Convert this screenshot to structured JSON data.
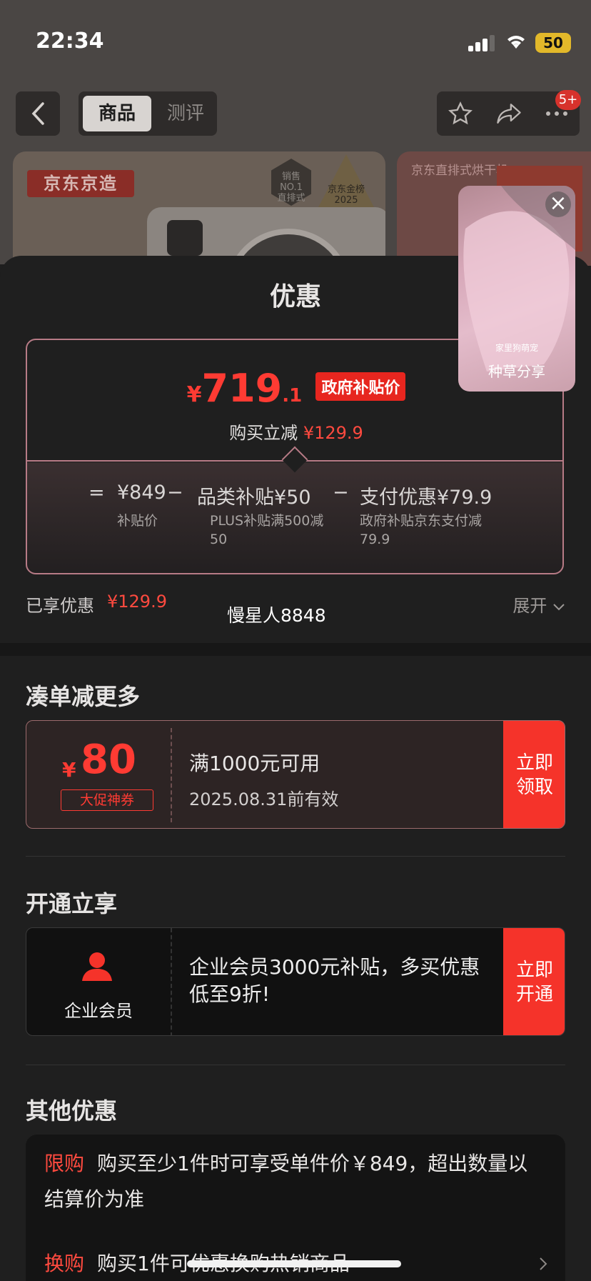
{
  "status_bar": {
    "time": "22:34",
    "battery": "50"
  },
  "nav": {
    "tabs": [
      {
        "label": "商品"
      },
      {
        "label": "测评"
      }
    ],
    "message_badge": "5+"
  },
  "product_images": {
    "brand_label": "京东京造",
    "sales_badge": "销售\nNO.1\n直排式",
    "gold_badge": "京东金榜\n2025",
    "second_title": "京东直排式烘干机…"
  },
  "floating_video": {
    "close": "×",
    "overlay_text": "家里狗萌宠",
    "caption": "种草分享"
  },
  "sheet": {
    "title": "优惠",
    "price": {
      "currency": "¥",
      "integer": "719",
      "decimal": ".1",
      "tag": "政府补贴价",
      "instant_label": "购买立减",
      "instant_value": "¥129.9"
    },
    "formula": {
      "equals": "=",
      "base_value": "¥849",
      "base_label": "补贴价",
      "minus": "−",
      "item1_value": "品类补贴¥50",
      "item1_label": "PLUS补贴满500减50",
      "item2_value": "支付优惠¥79.9",
      "item2_label": "政府补贴京东支付减79.9"
    },
    "enjoyed": {
      "label": "已享优惠",
      "value": "¥129.9",
      "expand": "展开"
    },
    "watermark": "慢星人8848",
    "more_section": {
      "title": "凑单减更多",
      "coupon": {
        "currency": "¥",
        "amount": "80",
        "tag": "大促神券",
        "condition": "满1000元可用",
        "expiry": "2025.08.31前有效",
        "button": "立即\n领取"
      }
    },
    "member_section": {
      "title": "开通立享",
      "label": "企业会员",
      "desc": "企业会员3000元补贴，多买优惠低至9折!",
      "button": "立即\n开通"
    },
    "other_section": {
      "title": "其他优惠",
      "rows": [
        {
          "tag": "限购",
          "text": "购买至少1件时可享受单件价￥849，超出数量以结算价为准"
        },
        {
          "tag": "换购",
          "text": "购买1件可优惠换购热销商品"
        }
      ]
    }
  },
  "colors": {
    "accent": "#f5332a",
    "price_red": "#ff3b33",
    "border_pink": "#b77b86"
  }
}
